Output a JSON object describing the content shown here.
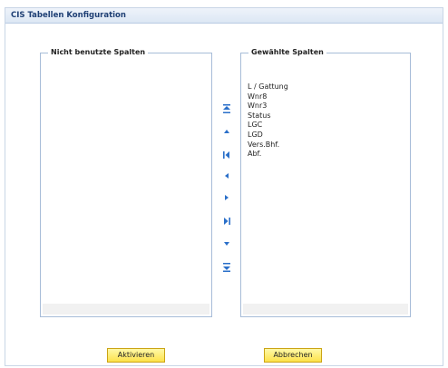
{
  "window": {
    "title": "CIS Tabellen Konfiguration"
  },
  "unused_columns": {
    "legend": "Nicht benutzte Spalten",
    "items": []
  },
  "selected_columns": {
    "legend": "Gewählte Spalten",
    "items": [
      "L / Gattung",
      "Wnr8",
      "Wnr3",
      "Status",
      "LGC",
      "LGD",
      "Vers.Bhf.",
      "Abf."
    ]
  },
  "move_controls": {
    "icon_color": "#2a6fc9",
    "buttons": [
      {
        "name": "move-to-top-icon"
      },
      {
        "name": "move-up-icon"
      },
      {
        "name": "move-all-left-icon"
      },
      {
        "name": "move-left-icon"
      },
      {
        "name": "move-right-icon"
      },
      {
        "name": "move-all-right-icon"
      },
      {
        "name": "move-down-icon"
      },
      {
        "name": "move-to-bottom-icon"
      }
    ]
  },
  "actions": {
    "activate_label": "Aktivieren",
    "cancel_label": "Abbrechen"
  },
  "colors": {
    "title_text": "#1e3f74",
    "border": "#a7bcd8",
    "button_fill": "#fde24a"
  }
}
